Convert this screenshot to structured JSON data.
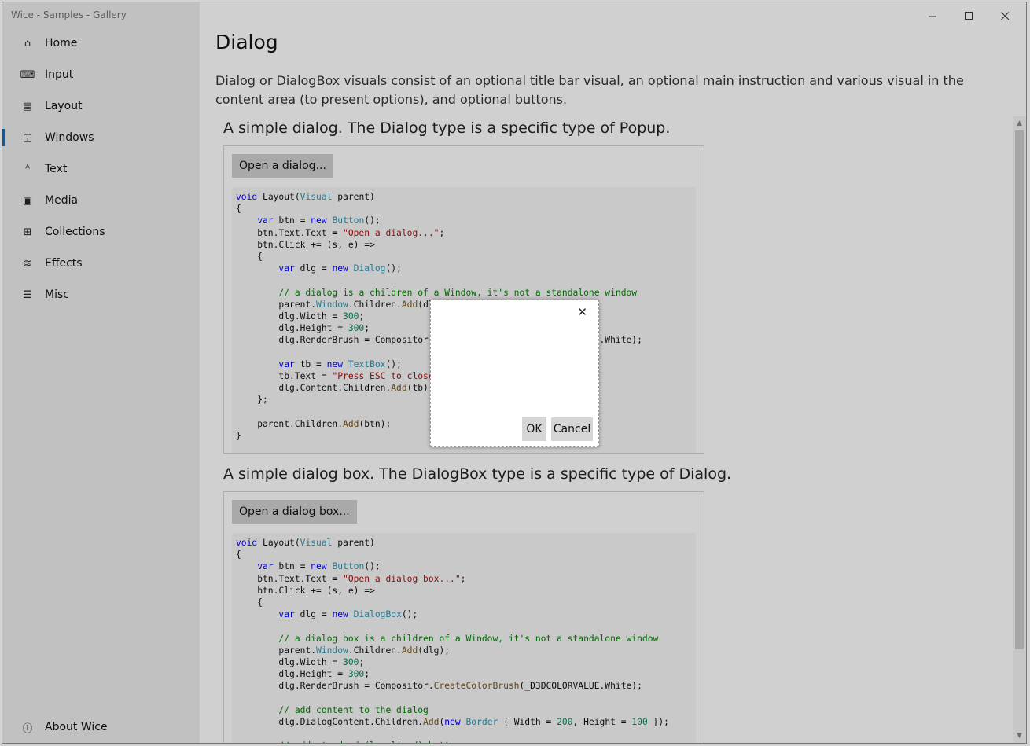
{
  "window": {
    "title": "Wice - Samples - Gallery",
    "minimize_icon": "minimize-icon",
    "maximize_icon": "maximize-icon",
    "close_icon": "close-icon"
  },
  "sidebar": {
    "items": [
      {
        "label": "Home",
        "icon": "home-icon",
        "glyph": "⌂"
      },
      {
        "label": "Input",
        "icon": "keyboard-icon",
        "glyph": "⌨"
      },
      {
        "label": "Layout",
        "icon": "layout-icon",
        "glyph": "▤"
      },
      {
        "label": "Windows",
        "icon": "windows-icon",
        "glyph": "◲"
      },
      {
        "label": "Text",
        "icon": "text-icon",
        "glyph": "ᴬ"
      },
      {
        "label": "Media",
        "icon": "media-icon",
        "glyph": "▣"
      },
      {
        "label": "Collections",
        "icon": "collections-icon",
        "glyph": "⊞"
      },
      {
        "label": "Effects",
        "icon": "effects-icon",
        "glyph": "≋"
      },
      {
        "label": "Misc",
        "icon": "misc-icon",
        "glyph": "☰"
      }
    ],
    "active": "Windows",
    "about": {
      "label": "About Wice",
      "icon": "info-icon",
      "glyph": "ⓘ"
    }
  },
  "main": {
    "title": "Dialog",
    "description": "Dialog or DialogBox visuals consist of an optional title bar visual, an optional main instruction and various visual in the content area (to present options), and optional buttons.",
    "sections": [
      {
        "title": "A simple dialog. The Dialog type is a specific type of Popup.",
        "button": "Open a dialog..."
      },
      {
        "title": "A simple dialog box. The DialogBox type is a specific type of Dialog.",
        "button": "Open a dialog box..."
      }
    ]
  },
  "dialog": {
    "close_glyph": "✕",
    "ok_label": "OK",
    "cancel_label": "Cancel"
  },
  "colors": {
    "accent": "#0f6cbd",
    "keyword": "#0000ff",
    "type": "#2b91af",
    "string": "#a31515",
    "comment": "#008000",
    "method": "#74531f"
  }
}
